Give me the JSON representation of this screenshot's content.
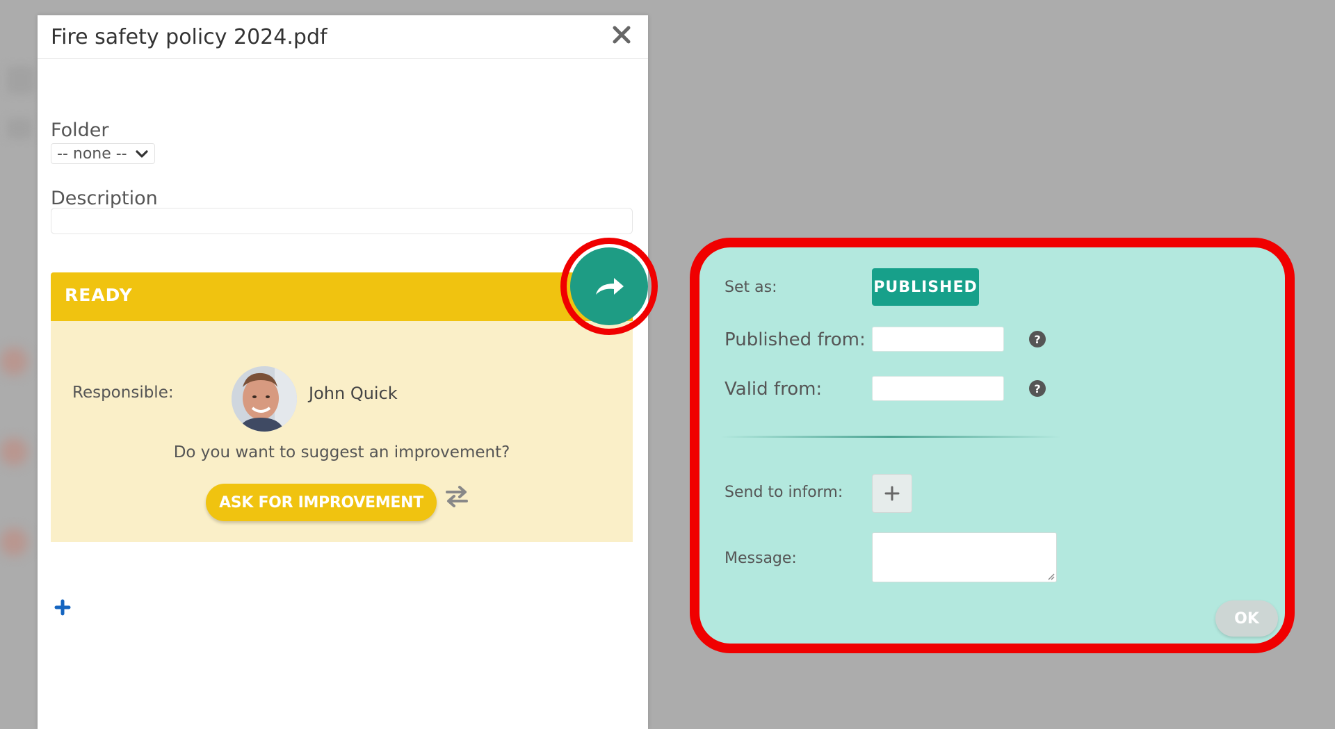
{
  "dialog": {
    "title": "Fire safety policy 2024.pdf",
    "folder_label": "Folder",
    "folder_value": "-- none --",
    "description_label": "Description",
    "description_value": ""
  },
  "status": {
    "label": "READY",
    "color": "#f0c310",
    "responsible_label": "Responsible:",
    "responsible_name": "John Quick",
    "suggest_text": "Do you want to suggest an improvement?",
    "ask_button": "ASK FOR IMPROVEMENT"
  },
  "icons": {
    "close": "close-icon",
    "transition": "share-arrow-icon",
    "swap": "swap-arrows-icon",
    "add": "plus-icon",
    "help": "question-circle-icon"
  },
  "colors": {
    "accent": "#1e9c84",
    "highlight": "#f00000",
    "panel_bg": "#b3e8de"
  },
  "panel": {
    "set_as_label": "Set as:",
    "set_as_value": "PUBLISHED",
    "published_from_label": "Published from:",
    "published_from_value": "",
    "valid_from_label": "Valid from:",
    "valid_from_value": "",
    "help_glyph": "?",
    "send_to_inform_label": "Send to inform:",
    "add_glyph": "+",
    "message_label": "Message:",
    "message_value": "",
    "ok_button": "OK"
  }
}
